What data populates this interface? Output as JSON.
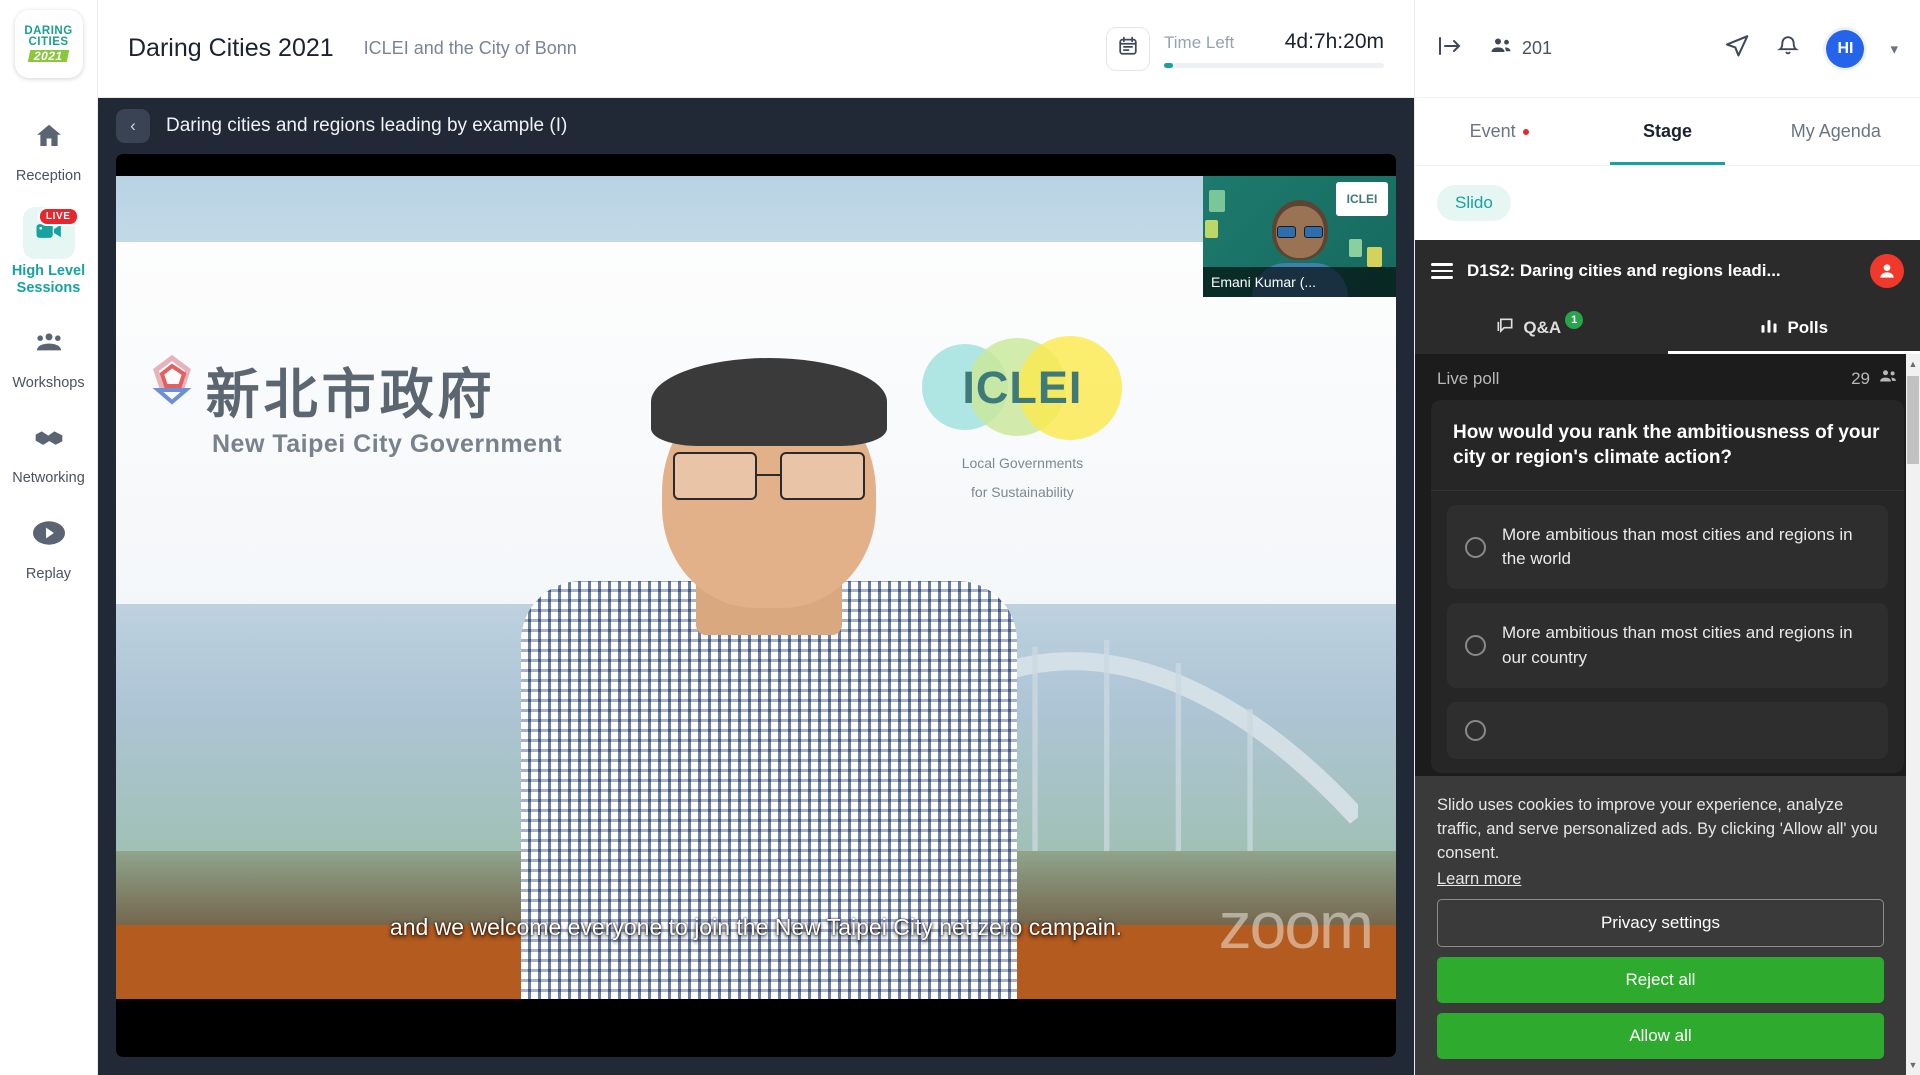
{
  "sidebar": {
    "logo": {
      "line1": "DARING",
      "line2": "CITIES",
      "line3": "2021"
    },
    "items": [
      {
        "label": "Reception",
        "icon": "home-icon",
        "active": false,
        "badge": ""
      },
      {
        "label": "High Level Sessions",
        "icon": "video-camera-icon",
        "active": true,
        "badge": "LIVE"
      },
      {
        "label": "Workshops",
        "icon": "people-group-icon",
        "active": false,
        "badge": ""
      },
      {
        "label": "Networking",
        "icon": "handshake-icon",
        "active": false,
        "badge": ""
      },
      {
        "label": "Replay",
        "icon": "play-circle-icon",
        "active": false,
        "badge": ""
      }
    ]
  },
  "topbar": {
    "event_title": "Daring Cities 2021",
    "event_subtitle": "ICLEI and the City of Bonn",
    "timer_label": "Time Left",
    "timer_value": "4d:7h:20m",
    "calendar_icon": "calendar-icon",
    "progress_percent": 4
  },
  "stage": {
    "back_icon": "chevron-left-icon",
    "session_title": "Daring cities and regions leading by example (I)",
    "caption": "and we welcome everyone to join the New Taipei City net zero campain.",
    "watermark": "zoom",
    "slide": {
      "org_cn": "新北市政府",
      "org_en": "New Taipei City Government",
      "iclei_name": "ICLEI",
      "iclei_tagline_1": "Local Governments",
      "iclei_tagline_2": "for Sustainability"
    },
    "pip": {
      "name": "Emani Kumar (...",
      "badge_text": "ICLEI"
    }
  },
  "right_panel": {
    "collapse_icon": "collapse-panel-icon",
    "people_icon": "people-icon",
    "people_count": "201",
    "send_icon": "send-icon",
    "bell_icon": "bell-icon",
    "avatar_initials": "HI",
    "chevron_icon": "chevron-down-icon",
    "tabs": [
      {
        "label": "Event",
        "active": false,
        "dot": true
      },
      {
        "label": "Stage",
        "active": true,
        "dot": false
      },
      {
        "label": "My Agenda",
        "active": false,
        "dot": false
      }
    ],
    "chip": "Slido"
  },
  "slido": {
    "menu_icon": "hamburger-menu-icon",
    "session_title": "D1S2: Daring cities and regions leadi...",
    "user_icon": "user-avatar-icon",
    "tabs": [
      {
        "label": "Q&A",
        "icon": "chat-bubble-icon",
        "badge": "1",
        "active": false
      },
      {
        "label": "Polls",
        "icon": "bar-chart-icon",
        "badge": "",
        "active": true
      }
    ],
    "live_label": "Live poll",
    "participants": "29",
    "participants_icon": "people-icon",
    "poll": {
      "question": "How would you rank the ambitiousness of your city or region's climate action?",
      "options": [
        {
          "text": "More ambitious than most cities and regions in the world",
          "selected": false
        },
        {
          "text": "More ambitious than most cities and regions in our country",
          "selected": false
        },
        {
          "text": "",
          "selected": false
        }
      ]
    },
    "cookie": {
      "text": "Slido uses cookies to improve your experience, analyze traffic, and serve personalized ads. By clicking 'Allow all' you consent.",
      "learn_more": "Learn more",
      "privacy_settings": "Privacy settings",
      "reject_all": "Reject all",
      "allow_all": "Allow all"
    }
  },
  "colors": {
    "accent_teal": "#17a2a2",
    "live_red": "#e8262d",
    "avatar_blue": "#2563eb",
    "cookie_green": "#2eab2e",
    "slido_red": "#f0392b",
    "qa_green": "#27a54a"
  }
}
